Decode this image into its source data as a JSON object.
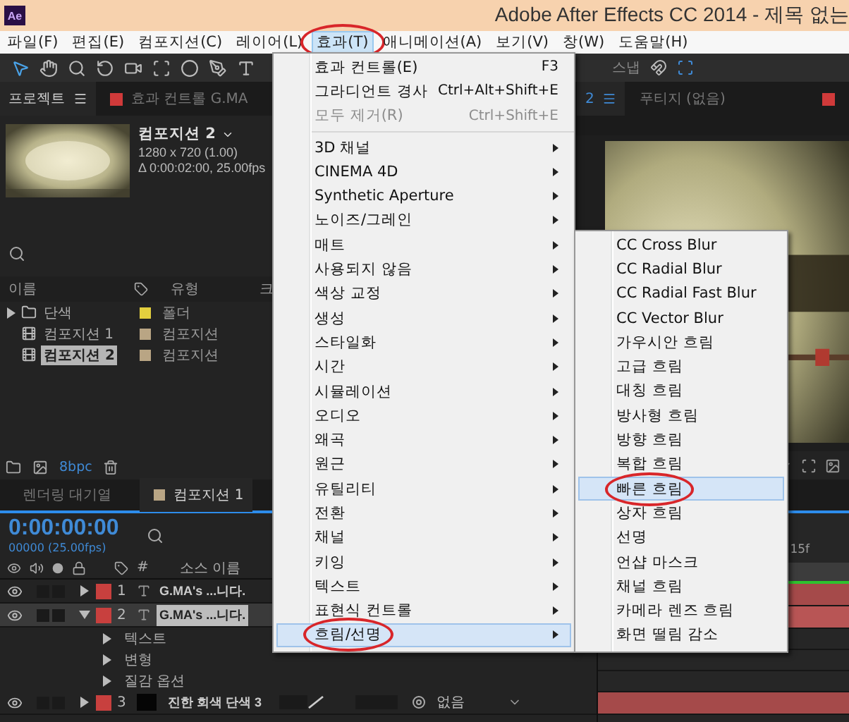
{
  "title_bar": {
    "app_icon": "Ae",
    "title": "Adobe After Effects CC 2014 - 제목 없는"
  },
  "menu_bar": [
    {
      "label": "파일(F)",
      "selected": false,
      "circled": false
    },
    {
      "label": "편집(E)",
      "selected": false,
      "circled": false
    },
    {
      "label": "컴포지션(C)",
      "selected": false,
      "circled": false
    },
    {
      "label": "레이어(L)",
      "selected": false,
      "circled": false
    },
    {
      "label": "효과(T)",
      "selected": true,
      "circled": true
    },
    {
      "label": "애니메이션(A)",
      "selected": false,
      "circled": false
    },
    {
      "label": "보기(V)",
      "selected": false,
      "circled": false
    },
    {
      "label": "창(W)",
      "selected": false,
      "circled": false
    },
    {
      "label": "도움말(H)",
      "selected": false,
      "circled": false
    }
  ],
  "toolbar": {
    "snap_label": "스냅"
  },
  "project_panel": {
    "tabs": [
      {
        "label": "프로젝트",
        "selected": true
      },
      {
        "label": "효과 컨트롤 G.MA",
        "selected": false
      }
    ],
    "composition": {
      "name": "컴포지션 2",
      "size": "1280 x 720 (1.00)",
      "duration": "Δ 0:00:02:00, 25.00fps"
    },
    "columns": [
      "이름",
      "유형",
      "크"
    ],
    "items": [
      {
        "kind": "folder",
        "name": "단색",
        "type": "폴더",
        "color": "#e3cf3e",
        "selected": false
      },
      {
        "kind": "composition",
        "name": "컴포지션 1",
        "type": "컴포지션",
        "color": "#b9a584",
        "selected": false
      },
      {
        "kind": "composition",
        "name": "컴포지션 2",
        "type": "컴포지션",
        "color": "#b9a584",
        "selected": true
      }
    ],
    "bit_depth": "8bpc"
  },
  "composition_panel": {
    "tabs": [
      {
        "label": "2",
        "selected": true
      },
      {
        "label": "푸티지 (없음)",
        "selected": false
      }
    ]
  },
  "timeline": {
    "tabs": [
      {
        "label": "렌더링 대기열",
        "selected": false
      },
      {
        "label": "컴포지션 1",
        "selected": true,
        "color": "#b9a584"
      }
    ],
    "timecode": "0:00:00:00",
    "frame_info": "00000 (25.00fps)",
    "columns": [
      "#",
      "소스 이름"
    ],
    "layers": [
      {
        "kind": "text",
        "index": "1",
        "name": "G.MA's ...니다.",
        "color": "#c8403e",
        "selected": false,
        "expanded": false
      },
      {
        "kind": "text",
        "index": "2",
        "name": "G.MA's ...니다.",
        "color": "#c8403e",
        "selected": true,
        "expanded": true,
        "children": [
          {
            "name": "텍스트"
          },
          {
            "name": "변형"
          },
          {
            "name": "질감 옵션"
          }
        ]
      },
      {
        "kind": "solid",
        "index": "3",
        "name": "진한 회색 단색 3",
        "color": "#c8403e",
        "selected": false,
        "expanded": false,
        "parent": "없음"
      }
    ],
    "ruler_label": "15f"
  },
  "effect_menu": {
    "items": [
      {
        "kind": "command",
        "label": "효과 컨트롤(E)",
        "shortcut": "F3",
        "disabled": false
      },
      {
        "kind": "command",
        "label": "그라디언트 경사",
        "shortcut": "Ctrl+Alt+Shift+E",
        "disabled": false
      },
      {
        "kind": "command",
        "label": "모두 제거(R)",
        "shortcut": "Ctrl+Shift+E",
        "disabled": true
      },
      {
        "kind": "separator"
      },
      {
        "kind": "submenu",
        "label": "3D 채널",
        "selected": false,
        "circled": false
      },
      {
        "kind": "submenu",
        "label": "CINEMA 4D",
        "selected": false,
        "circled": false
      },
      {
        "kind": "submenu",
        "label": "Synthetic Aperture",
        "selected": false,
        "circled": false
      },
      {
        "kind": "submenu",
        "label": "노이즈/그레인",
        "selected": false,
        "circled": false
      },
      {
        "kind": "submenu",
        "label": "매트",
        "selected": false,
        "circled": false
      },
      {
        "kind": "submenu",
        "label": "사용되지 않음",
        "selected": false,
        "circled": false
      },
      {
        "kind": "submenu",
        "label": "색상 교정",
        "selected": false,
        "circled": false
      },
      {
        "kind": "submenu",
        "label": "생성",
        "selected": false,
        "circled": false
      },
      {
        "kind": "submenu",
        "label": "스타일화",
        "selected": false,
        "circled": false
      },
      {
        "kind": "submenu",
        "label": "시간",
        "selected": false,
        "circled": false
      },
      {
        "kind": "submenu",
        "label": "시뮬레이션",
        "selected": false,
        "circled": false
      },
      {
        "kind": "submenu",
        "label": "오디오",
        "selected": false,
        "circled": false
      },
      {
        "kind": "submenu",
        "label": "왜곡",
        "selected": false,
        "circled": false
      },
      {
        "kind": "submenu",
        "label": "원근",
        "selected": false,
        "circled": false
      },
      {
        "kind": "submenu",
        "label": "유틸리티",
        "selected": false,
        "circled": false
      },
      {
        "kind": "submenu",
        "label": "전환",
        "selected": false,
        "circled": false
      },
      {
        "kind": "submenu",
        "label": "채널",
        "selected": false,
        "circled": false
      },
      {
        "kind": "submenu",
        "label": "키잉",
        "selected": false,
        "circled": false
      },
      {
        "kind": "submenu",
        "label": "텍스트",
        "selected": false,
        "circled": false
      },
      {
        "kind": "submenu",
        "label": "표현식 컨트롤",
        "selected": false,
        "circled": false
      },
      {
        "kind": "submenu",
        "label": "흐림/선명",
        "selected": true,
        "circled": true
      }
    ]
  },
  "blur_submenu": {
    "items": [
      {
        "label": "CC Cross Blur",
        "selected": false,
        "circled": false
      },
      {
        "label": "CC Radial Blur",
        "selected": false,
        "circled": false
      },
      {
        "label": "CC Radial Fast Blur",
        "selected": false,
        "circled": false
      },
      {
        "label": "CC Vector Blur",
        "selected": false,
        "circled": false
      },
      {
        "label": "가우시안 흐림",
        "selected": false,
        "circled": false
      },
      {
        "label": "고급 흐림",
        "selected": false,
        "circled": false
      },
      {
        "label": "대칭 흐림",
        "selected": false,
        "circled": false
      },
      {
        "label": "방사형 흐림",
        "selected": false,
        "circled": false
      },
      {
        "label": "방향 흐림",
        "selected": false,
        "circled": false
      },
      {
        "label": "복합 흐림",
        "selected": false,
        "circled": false
      },
      {
        "label": "빠른 흐림",
        "selected": true,
        "circled": true
      },
      {
        "label": "상자 흐림",
        "selected": false,
        "circled": false
      },
      {
        "label": "선명",
        "selected": false,
        "circled": false
      },
      {
        "label": "언샵 마스크",
        "selected": false,
        "circled": false
      },
      {
        "label": "채널 흐림",
        "selected": false,
        "circled": false
      },
      {
        "label": "카메라 렌즈 흐림",
        "selected": false,
        "circled": false
      },
      {
        "label": "화면 떨림 감소",
        "selected": false,
        "circled": false
      }
    ]
  }
}
